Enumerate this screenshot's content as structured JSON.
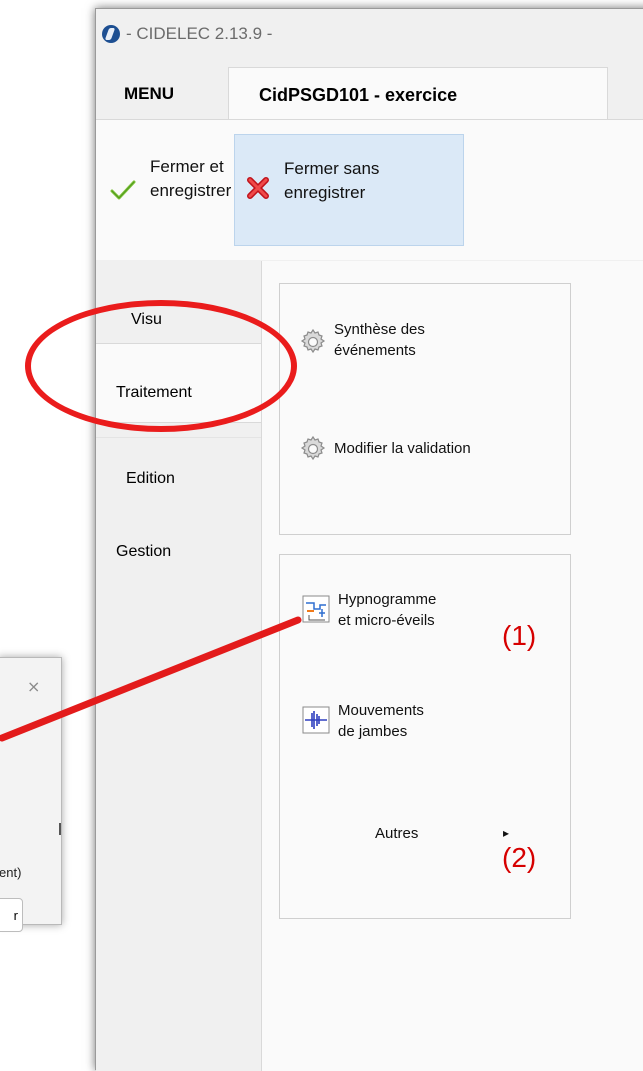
{
  "window": {
    "title": "- CIDELEC 2.13.9 -",
    "menu_tab": "MENU",
    "doc_tab": "CidPSGD101 - exercice"
  },
  "ribbon": {
    "save_line1": "Fermer et",
    "save_line2": "enregistrer",
    "nosave_line1": "Fermer sans",
    "nosave_line2": "enregistrer"
  },
  "sidebar": {
    "items": [
      "Visu",
      "Traitement",
      "Edition",
      "Gestion"
    ]
  },
  "group1": {
    "synthese_line1": "Synthèse des",
    "synthese_line2": "événements",
    "modifier": "Modifier la validation"
  },
  "group2": {
    "hypno_line1": "Hypnogramme",
    "hypno_line2": "et micro-éveils",
    "mouv_line1": "Mouvements",
    "mouv_line2": "de jambes",
    "autres": "Autres",
    "autres_arrow": "▸"
  },
  "annotations": {
    "label1": "(1)",
    "label2": "(2)"
  },
  "background_dialog": {
    "close": "×",
    "text": "ent)",
    "button": "r"
  },
  "colors": {
    "highlight": "#ea1c1c",
    "selected_button_bg": "#dbe9f7",
    "accent_blue": "#1d4f92"
  }
}
